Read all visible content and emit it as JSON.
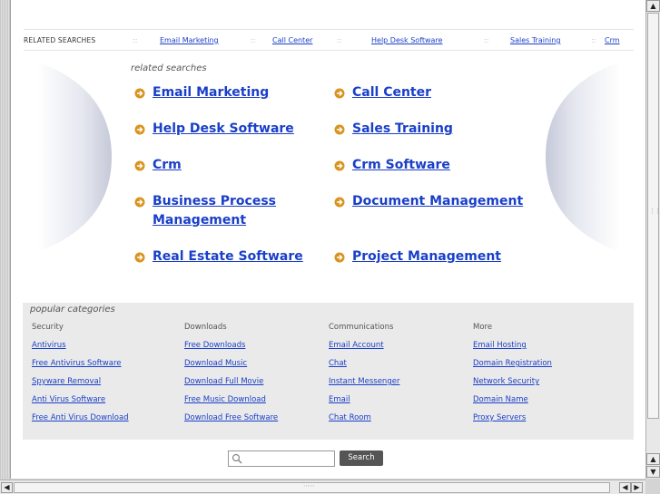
{
  "top_bar": {
    "label": "RELATED SEARCHES",
    "separator": "::",
    "links": [
      "Email Marketing",
      "Call Center",
      "Help Desk Software",
      "Sales Training",
      "Crm"
    ]
  },
  "related": {
    "title": "related searches",
    "items": [
      "Email Marketing",
      "Call Center",
      "Help Desk Software",
      "Sales Training",
      "Crm",
      "Crm Software",
      "Business Process Management",
      "Document Management",
      "Real Estate Software",
      "Project Management"
    ]
  },
  "categories": {
    "title": "popular categories",
    "columns": [
      {
        "title": "Security",
        "links": [
          "Antivirus",
          "Free Antivirus Software",
          "Spyware Removal",
          "Anti Virus Software",
          "Free Anti Virus Download"
        ]
      },
      {
        "title": "Downloads",
        "links": [
          "Free Downloads",
          "Download Music",
          "Download Full Movie",
          "Free Music Download",
          "Download Free Software"
        ]
      },
      {
        "title": "Communications",
        "links": [
          "Email Account",
          "Chat",
          "Instant Messenger",
          "Email",
          "Chat Room"
        ]
      },
      {
        "title": "More",
        "links": [
          "Email Hosting",
          "Domain Registration",
          "Network Security",
          "Domain Name",
          "Proxy Servers"
        ]
      }
    ]
  },
  "search": {
    "value": "",
    "button_label": "Search"
  },
  "scrollbar": {
    "up": "▲",
    "down": "▼",
    "left": "◀",
    "right": "▶"
  },
  "colors": {
    "link": "#1a3fc8",
    "arrow": "#d9931e",
    "panel": "#eaeaea"
  }
}
